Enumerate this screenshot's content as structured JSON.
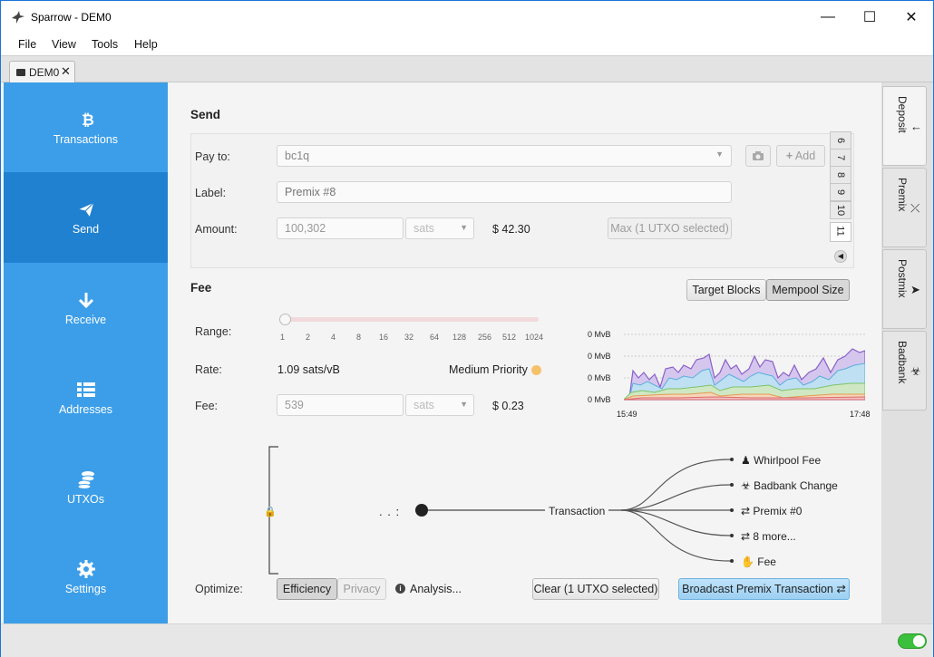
{
  "window": {
    "title": "Sparrow - DEM0"
  },
  "menu": [
    "File",
    "View",
    "Tools",
    "Help"
  ],
  "tab": {
    "label": "DEM0"
  },
  "sidebar": {
    "items": [
      {
        "label": "Transactions",
        "icon": "bitcoin-icon"
      },
      {
        "label": "Send",
        "icon": "paper-plane-icon"
      },
      {
        "label": "Receive",
        "icon": "arrow-down-icon"
      },
      {
        "label": "Addresses",
        "icon": "list-icon"
      },
      {
        "label": "UTXOs",
        "icon": "coins-icon"
      },
      {
        "label": "Settings",
        "icon": "gear-icon"
      }
    ]
  },
  "send": {
    "heading": "Send",
    "pay_to_label": "Pay to:",
    "pay_to_value": "bc1q",
    "add_label": "Add",
    "label_label": "Label:",
    "label_placeholder": "Premix #8",
    "amount_label": "Amount:",
    "amount_value": "100,302",
    "amount_unit": "sats",
    "amount_fiat": "$ 42.30",
    "max_label": "Max (1 UTXO selected)",
    "tabs": [
      "6",
      "7",
      "8",
      "9",
      "10",
      "11"
    ]
  },
  "fee": {
    "heading": "Fee",
    "target_blocks": "Target Blocks",
    "mempool_size": "Mempool Size",
    "range_label": "Range:",
    "range_ticks": [
      "1",
      "2",
      "4",
      "8",
      "16",
      "32",
      "64",
      "128",
      "256",
      "512",
      "1024"
    ],
    "rate_label": "Rate:",
    "rate_value": "1.09 sats/vB",
    "priority": "Medium Priority",
    "fee_label": "Fee:",
    "fee_value": "539",
    "fee_unit": "sats",
    "fee_fiat": "$ 0.23",
    "chart_y_labels": [
      "0 MvB",
      "0 MvB",
      "0 MvB",
      "0 MvB"
    ],
    "chart_x_start": "15:49",
    "chart_x_end": "17:48"
  },
  "chart_data": {
    "type": "area",
    "x_labels": [
      "15:49",
      "17:48"
    ],
    "y_tick_labels": [
      "0 MvB",
      "0 MvB",
      "0 MvB",
      "0 MvB"
    ]
  },
  "diagram": {
    "dots": ". . :",
    "transaction": "Transaction",
    "outputs": [
      "Whirlpool Fee",
      "Badbank Change",
      "Premix #0",
      "8 more...",
      "Fee"
    ]
  },
  "bottom": {
    "optimize_label": "Optimize:",
    "efficiency": "Efficiency",
    "privacy": "Privacy",
    "analysis": "Analysis...",
    "clear": "Clear (1 UTXO selected)",
    "broadcast": "Broadcast Premix Transaction"
  },
  "right_tabs": [
    "Deposit",
    "Premix",
    "Postmix",
    "Badbank"
  ],
  "colors": {
    "sidebar": "#3c9ee8",
    "sidebar_active": "#2081d0",
    "accent_button": "#a9d6f5",
    "priority_dot": "#f5c26b",
    "toggle": "#3cbf3c"
  }
}
